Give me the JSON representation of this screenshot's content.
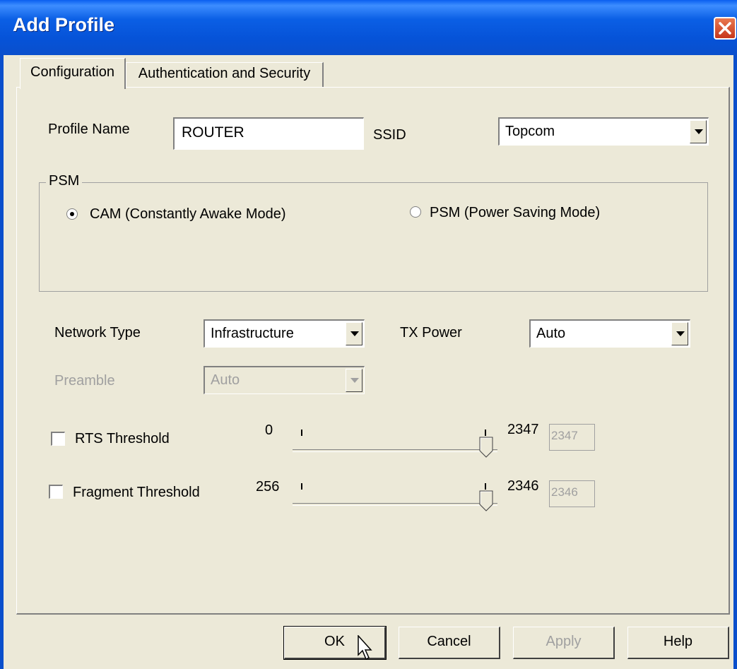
{
  "window": {
    "title": "Add Profile"
  },
  "tabs": [
    {
      "label": "Configuration"
    },
    {
      "label": "Authentication and Security"
    }
  ],
  "profile": {
    "label": "Profile Name",
    "value": "ROUTER"
  },
  "ssid": {
    "label": "SSID",
    "value": "Topcom"
  },
  "psm_group": {
    "title": "PSM",
    "options": [
      {
        "label": "CAM (Constantly Awake Mode)",
        "selected": true
      },
      {
        "label": "PSM (Power Saving Mode)",
        "selected": false
      }
    ]
  },
  "network_type": {
    "label": "Network Type",
    "value": "Infrastructure"
  },
  "tx_power": {
    "label": "TX Power",
    "value": "Auto"
  },
  "preamble": {
    "label": "Preamble",
    "value": "Auto",
    "disabled": true
  },
  "rts": {
    "label": "RTS Threshold",
    "checked": false,
    "min": "0",
    "max": "2347",
    "value": "2347"
  },
  "fragment": {
    "label": "Fragment Threshold",
    "checked": false,
    "min": "256",
    "max": "2346",
    "value": "2346"
  },
  "buttons": {
    "ok": "OK",
    "cancel": "Cancel",
    "apply": "Apply",
    "help": "Help"
  },
  "icons": {
    "close": "close-icon",
    "dropdown": "chevron-down-icon",
    "cursor": "mouse-pointer-icon"
  }
}
